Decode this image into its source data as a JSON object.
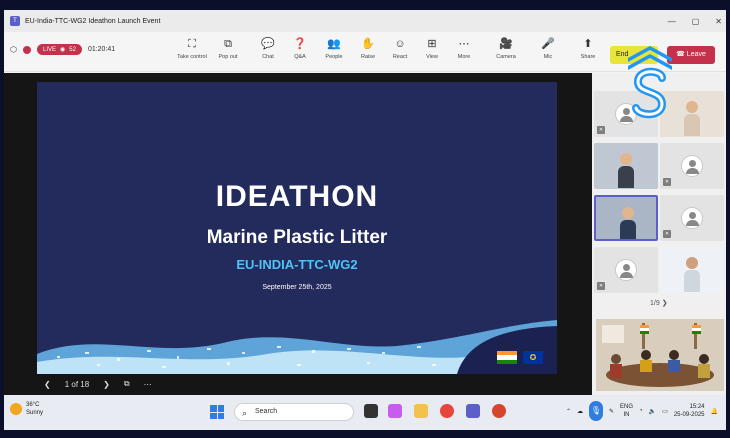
{
  "window": {
    "title": "EU-India-TTC-WG2 Ideathon Launch Event",
    "controls": [
      "—",
      "▢",
      "✕"
    ]
  },
  "meeting": {
    "live_label": "LIVE",
    "viewer_count": "52",
    "elapsed": "01:20:41",
    "tools": [
      {
        "label": "Take control",
        "icon": "take-control-icon",
        "glyph": "⛶"
      },
      {
        "label": "Pop out",
        "icon": "pop-out-icon",
        "glyph": "⧉"
      },
      {
        "label": "Chat",
        "icon": "chat-icon",
        "glyph": "💬"
      },
      {
        "label": "Q&A",
        "icon": "qa-icon",
        "glyph": "❓"
      },
      {
        "label": "People",
        "icon": "people-icon",
        "glyph": "👥"
      },
      {
        "label": "Raise",
        "icon": "raise-hand-icon",
        "glyph": "✋"
      },
      {
        "label": "React",
        "icon": "react-icon",
        "glyph": "☺"
      },
      {
        "label": "View",
        "icon": "view-icon",
        "glyph": "⊞"
      },
      {
        "label": "More",
        "icon": "more-icon",
        "glyph": "⋯"
      },
      {
        "label": "Camera",
        "icon": "camera-icon",
        "glyph": "🎥"
      },
      {
        "label": "Mic",
        "icon": "mic-icon",
        "glyph": "🎤"
      },
      {
        "label": "Share",
        "icon": "share-icon",
        "glyph": "⬆"
      }
    ],
    "end_label": "End",
    "leave_label": "Leave"
  },
  "slide": {
    "title": "IDEATHON",
    "subtitle": "Marine Plastic Litter",
    "code": "EU-INDIA-TTC-WG2",
    "date": "September 25th, 2025",
    "page_indicator": "1 of 18"
  },
  "participants": {
    "pager": "1/9"
  },
  "taskbar": {
    "temperature": "36°C",
    "condition": "Sunny",
    "search_placeholder": "Search",
    "language_top": "ENG",
    "language_bottom": "IN",
    "time": "15:24",
    "date": "25-09-2025"
  },
  "colors": {
    "accent": "#5b5fc7",
    "live": "#c4314b",
    "slide_bg": "#232a5c",
    "slide_code": "#4fc3f7",
    "end_button": "#e8e53a"
  }
}
